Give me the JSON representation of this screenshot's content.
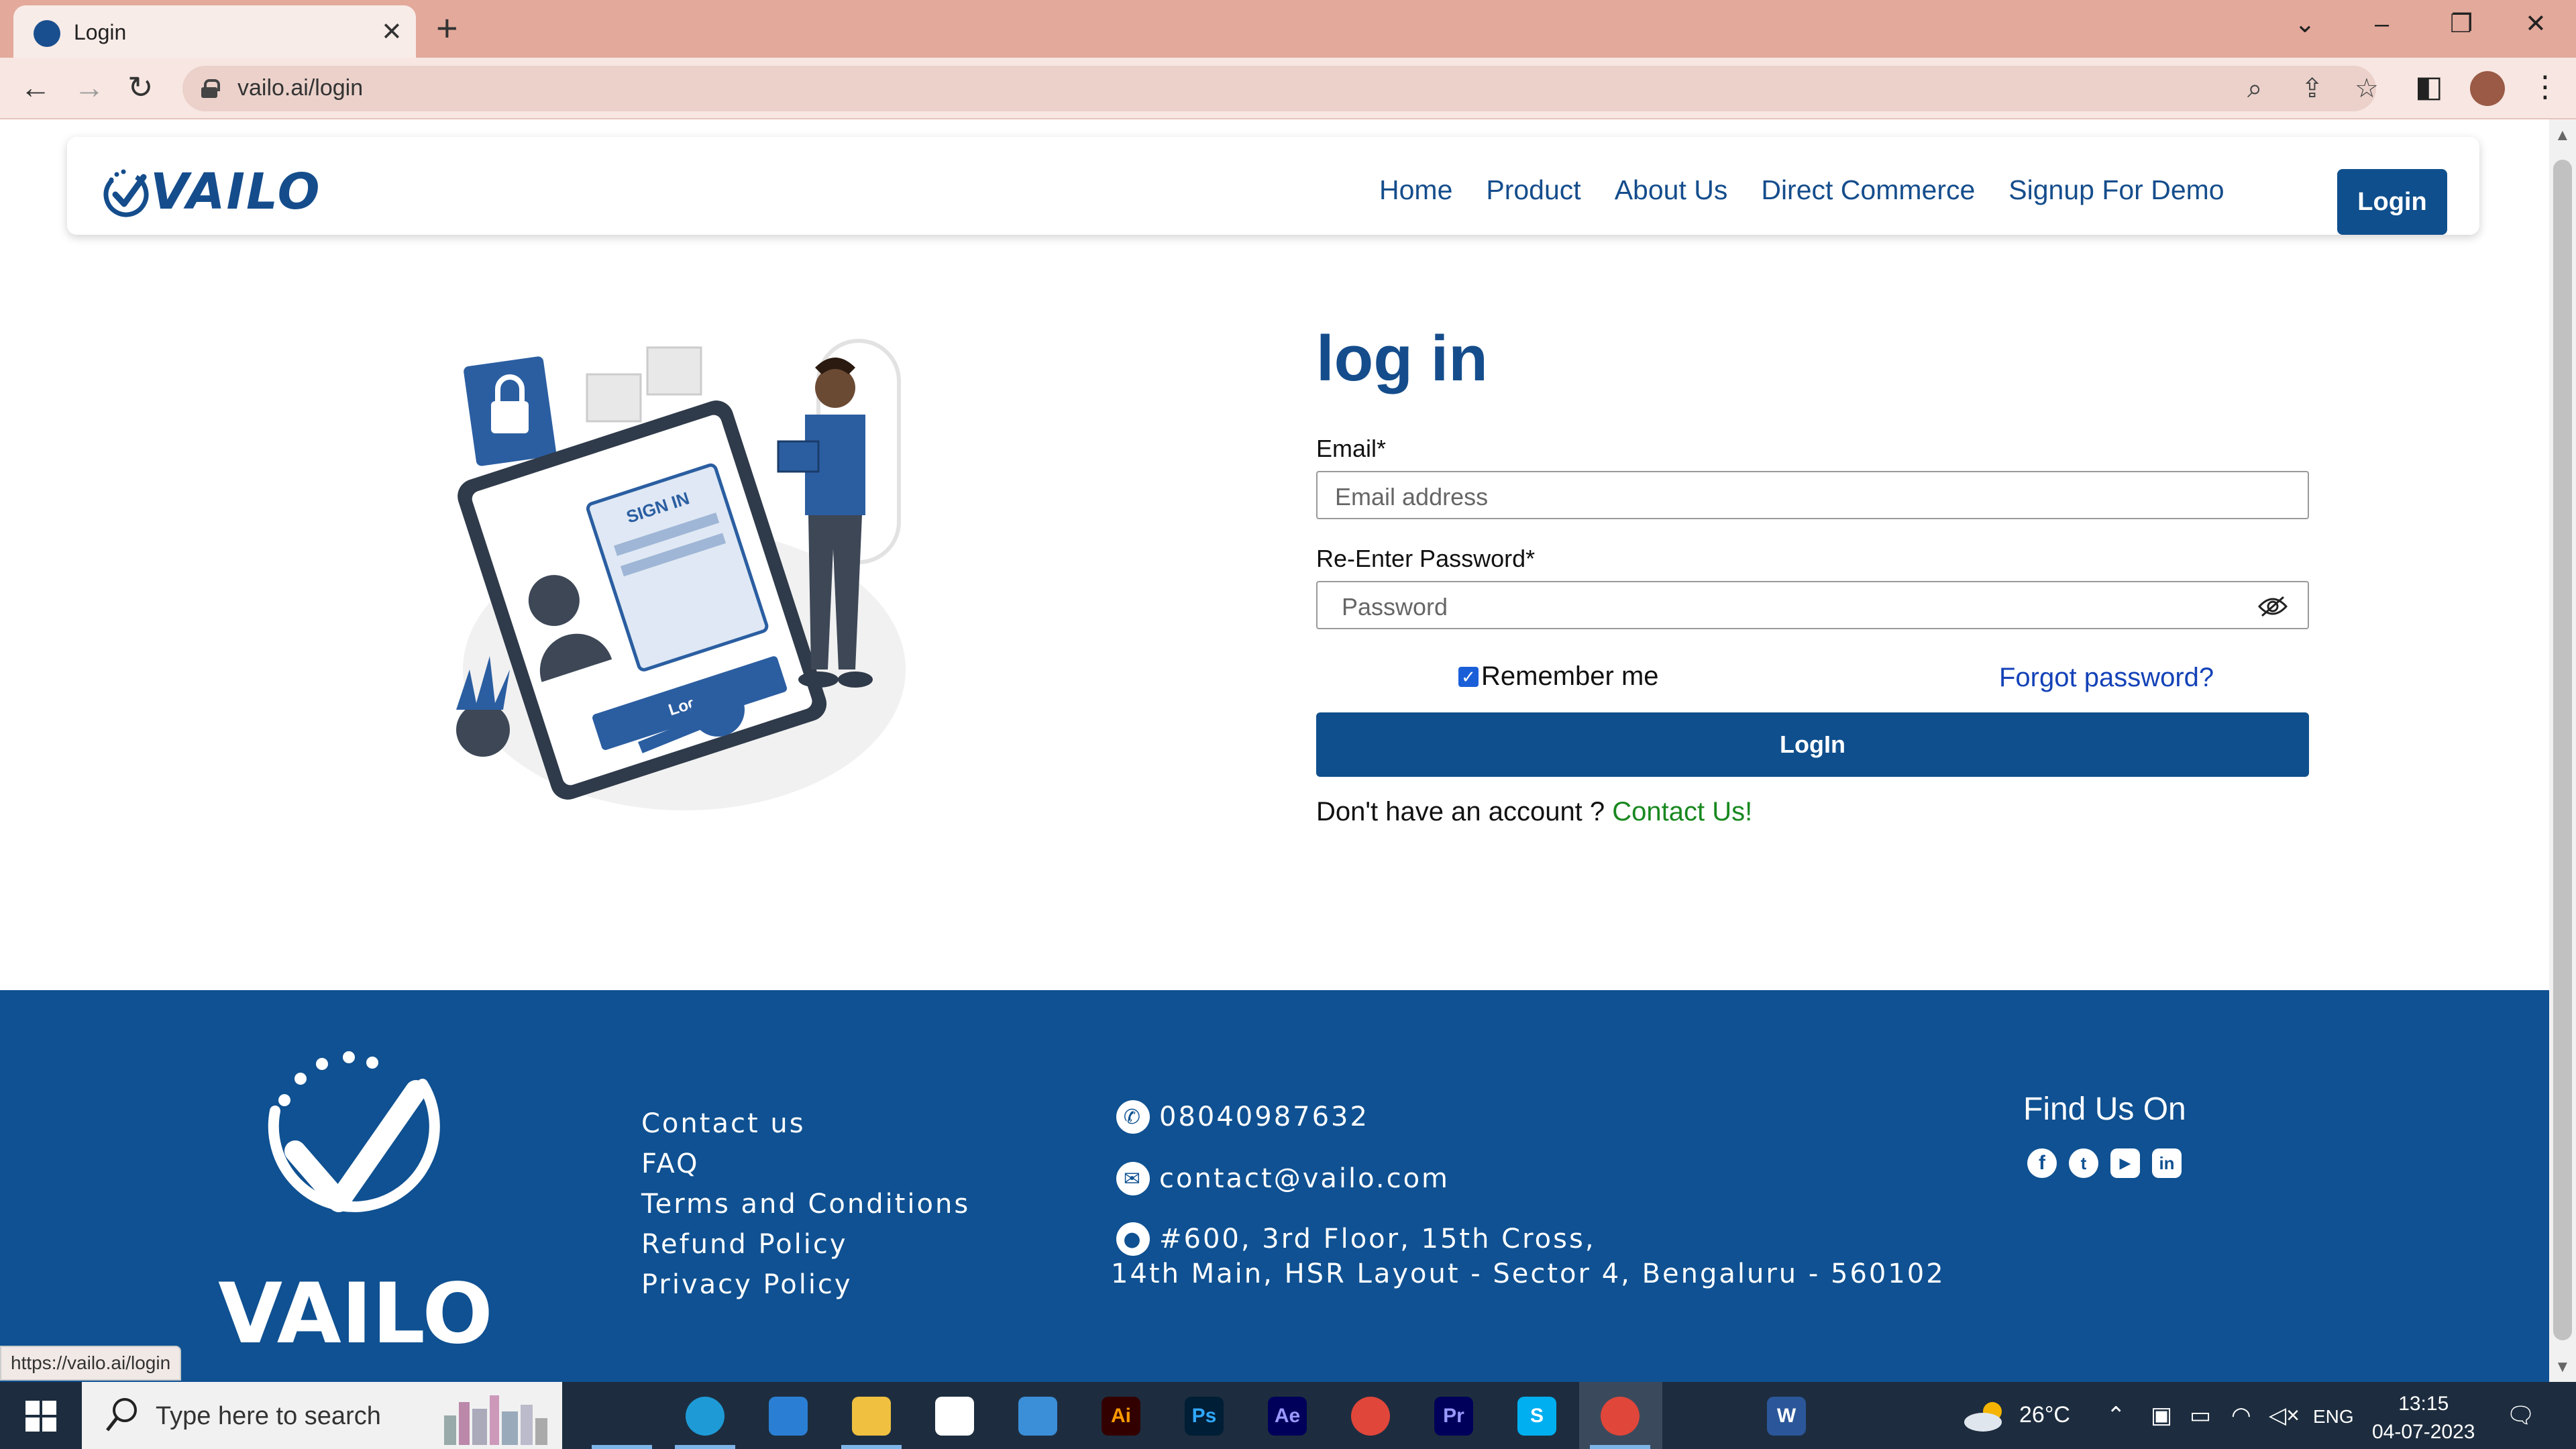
{
  "browser": {
    "tab_title": "Login",
    "url": "vailo.ai/login",
    "status_url": "https://vailo.ai/login"
  },
  "header": {
    "logo_text": "VAILO",
    "nav": [
      "Home",
      "Product",
      "About Us",
      "Direct Commerce",
      "Signup For Demo"
    ],
    "login_button": "Login"
  },
  "login": {
    "title": "log in",
    "email_label": "Email*",
    "email_placeholder": "Email address",
    "password_label": "Re-Enter Password*",
    "password_placeholder": "Password",
    "remember_label": "Remember me",
    "remember_checked": true,
    "forgot_link": "Forgot password?",
    "submit_label": "LogIn",
    "no_account_text": "Don't have an account ? ",
    "contact_link": "Contact Us!"
  },
  "illustration": {
    "sign_in_text": "SIGN IN",
    "button_text": "Login"
  },
  "footer": {
    "logo_text": "VAILO",
    "links": [
      "Contact us",
      "FAQ",
      "Terms and Conditions",
      "Refund Policy",
      "Privacy Policy"
    ],
    "phone": "08040987632",
    "email": "contact@vailo.com",
    "address_line1": "#600, 3rd Floor, 15th Cross,",
    "address_line2": "14th Main, HSR Layout - Sector 4, Bengaluru - 560102",
    "find_us": "Find Us On",
    "socials": [
      "facebook-icon",
      "twitter-icon",
      "youtube-icon",
      "linkedin-icon"
    ]
  },
  "taskbar": {
    "search_placeholder": "Type here to search",
    "apps": [
      {
        "name": "task-view-icon",
        "label": "",
        "bg": "#1d2d3f",
        "fg": "#ffffff"
      },
      {
        "name": "edge-icon",
        "label": "",
        "bg": "#1e9bd7",
        "fg": "#ffffff"
      },
      {
        "name": "mail-icon",
        "label": "",
        "bg": "#2a7fd4",
        "fg": "#ffffff"
      },
      {
        "name": "file-explorer-icon",
        "label": "",
        "bg": "#f0c040",
        "fg": "#ffffff"
      },
      {
        "name": "store-icon",
        "label": "",
        "bg": "#ffffff",
        "fg": "#0078d4"
      },
      {
        "name": "photos-icon",
        "label": "",
        "bg": "#3b8ed8",
        "fg": "#ffffff"
      },
      {
        "name": "illustrator-icon",
        "label": "Ai",
        "bg": "#330000",
        "fg": "#ff9a00"
      },
      {
        "name": "photoshop-icon",
        "label": "Ps",
        "bg": "#001e36",
        "fg": "#31a8ff"
      },
      {
        "name": "after-effects-icon",
        "label": "Ae",
        "bg": "#00005b",
        "fg": "#9999ff"
      },
      {
        "name": "chrome-icon",
        "label": "",
        "bg": "#e0463a",
        "fg": "#ffffff"
      },
      {
        "name": "premiere-icon",
        "label": "Pr",
        "bg": "#00005b",
        "fg": "#9999ff"
      },
      {
        "name": "skype-icon",
        "label": "S",
        "bg": "#00aff0",
        "fg": "#ffffff"
      },
      {
        "name": "chrome-active-icon",
        "label": "",
        "bg": "#e0463a",
        "fg": "#ffffff"
      },
      {
        "name": "vscode-icon",
        "label": "",
        "bg": "#1d2d3f",
        "fg": "#2ea4f0"
      },
      {
        "name": "word-icon",
        "label": "W",
        "bg": "#2b579a",
        "fg": "#ffffff"
      }
    ],
    "weather": "26°C",
    "language": "ENG",
    "time": "13:15",
    "date": "04-07-2023"
  },
  "colors": {
    "brand": "#154d8c",
    "button": "#0f4f8d",
    "footer_bg": "#0f5192",
    "link_blue": "#1442b8",
    "link_green": "#18881f",
    "tab_strip": "#e3a99b"
  }
}
